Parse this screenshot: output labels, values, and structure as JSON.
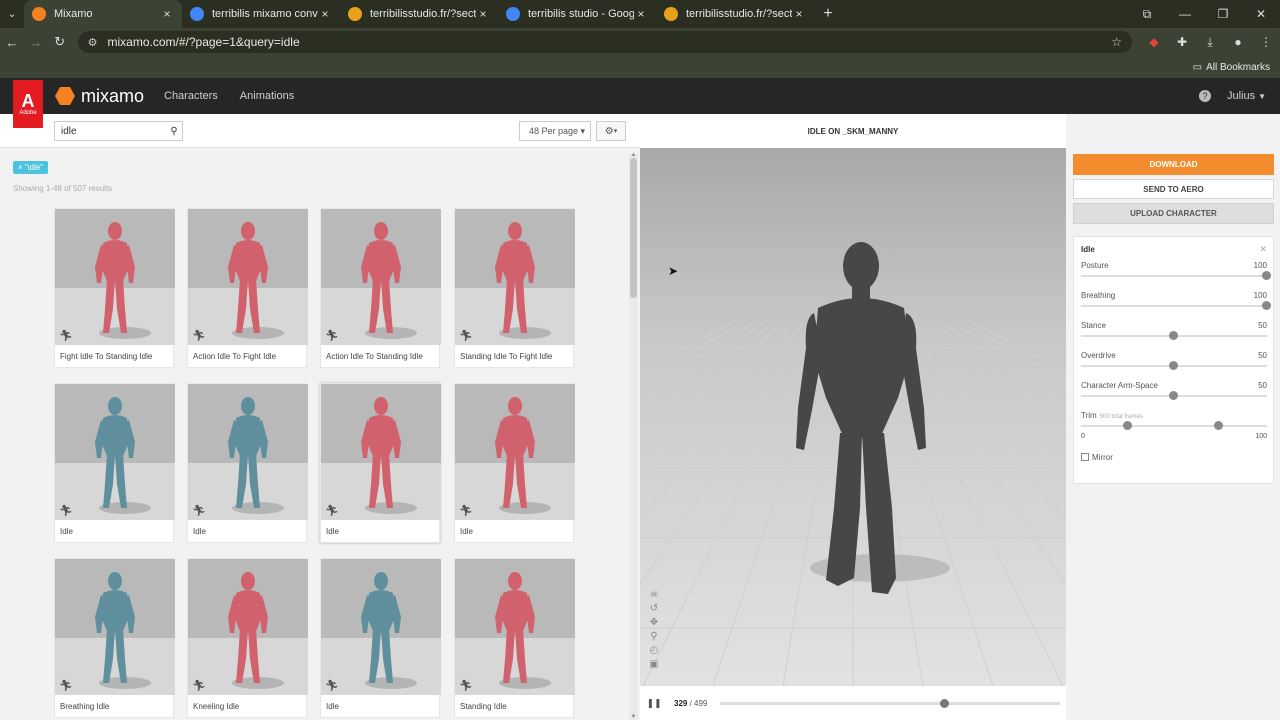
{
  "browser": {
    "tabs": [
      {
        "title": "Mixamo",
        "active": true,
        "favicon_color": "#f58220",
        "favicon": "mixamo-icon"
      },
      {
        "title": "terribilis mixamo converter - Go",
        "active": false,
        "favicon_color": "#4285f4",
        "favicon": "google-icon"
      },
      {
        "title": "terribilisstudio.fr/?section=MC",
        "active": false,
        "favicon_color": "#e8a21a",
        "favicon": "site-icon"
      },
      {
        "title": "terribilis studio - Google Search",
        "active": false,
        "favicon_color": "#4285f4",
        "favicon": "google-icon"
      },
      {
        "title": "terribilisstudio.fr/?section=MC",
        "active": false,
        "favicon_color": "#e8a21a",
        "favicon": "site-icon"
      }
    ],
    "url": "mixamo.com/#/?page=1&query=idle",
    "bookmarks_label": "All Bookmarks"
  },
  "header": {
    "adobe_text": "Adobe",
    "brand": "mixamo",
    "nav": [
      "Characters",
      "Animations"
    ],
    "user": "Julius"
  },
  "search": {
    "value": "idle",
    "per_page": "48 Per page",
    "chip": "× \"idle\"",
    "showing": "Showing 1-48 of 507 results"
  },
  "animations": [
    {
      "label": "Fight Idle To Standing Idle",
      "color": "#d1616d"
    },
    {
      "label": "Action Idle To Fight Idle",
      "color": "#d1616d"
    },
    {
      "label": "Action Idle To Standing Idle",
      "color": "#d1616d"
    },
    {
      "label": "Standing Idle To Fight Idle",
      "color": "#d1616d"
    },
    {
      "label": "Idle",
      "color": "#5f8f9c"
    },
    {
      "label": "Idle",
      "color": "#5f8f9c"
    },
    {
      "label": "Idle",
      "color": "#d1616d",
      "selected": true
    },
    {
      "label": "Idle",
      "color": "#d1616d"
    },
    {
      "label": "Breathing Idle",
      "color": "#5f8f9c"
    },
    {
      "label": "Kneeling Idle",
      "color": "#d1616d"
    },
    {
      "label": "Idle",
      "color": "#5f8f9c"
    },
    {
      "label": "Standing Idle",
      "color": "#d1616d"
    }
  ],
  "viewer": {
    "title": "IDLE ON _SKM_MANNY",
    "current_frame": "329",
    "frames_sep": " / ",
    "total_frames": "499",
    "progress": 0.66
  },
  "actions": {
    "download": "DOWNLOAD",
    "send_aero": "SEND TO AERO",
    "upload": "UPLOAD CHARACTER"
  },
  "properties": {
    "title": "Idle",
    "sliders": [
      {
        "label": "Posture",
        "value": "100",
        "fraction": 1.0
      },
      {
        "label": "Breathing",
        "value": "100",
        "fraction": 1.0
      },
      {
        "label": "Stance",
        "value": "50",
        "fraction": 0.5
      },
      {
        "label": "Overdrive",
        "value": "50",
        "fraction": 0.5
      },
      {
        "label": "Character Arm-Space",
        "value": "50",
        "fraction": 0.5
      }
    ],
    "trim": {
      "label": "Trim",
      "hint": "500 total frames",
      "min": "0",
      "max": "100",
      "start": 0.25,
      "end": 0.74
    },
    "mirror_label": "Mirror"
  }
}
